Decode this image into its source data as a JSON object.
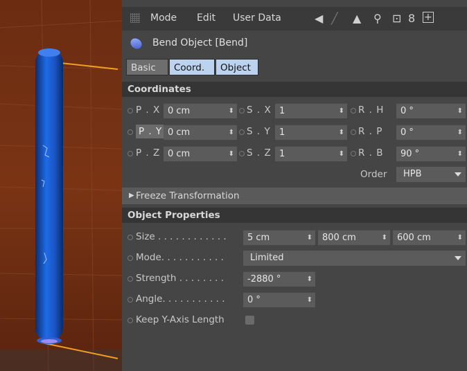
{
  "menu": {
    "mode": "Mode",
    "edit": "Edit",
    "userdata": "User Data"
  },
  "object_title": "Bend Object [Bend]",
  "tabs": [
    "Basic",
    "Coord.",
    "Object"
  ],
  "sections": {
    "coordinates": "Coordinates",
    "object_properties": "Object Properties",
    "freeze": "Freeze Transformation"
  },
  "coords": {
    "position": [
      {
        "label": "P . X",
        "value": "0 cm"
      },
      {
        "label": "P . Y",
        "value": "0 cm"
      },
      {
        "label": "P . Z",
        "value": "0 cm"
      }
    ],
    "scale": [
      {
        "label": "S . X",
        "value": "1"
      },
      {
        "label": "S . Y",
        "value": "1"
      },
      {
        "label": "S . Z",
        "value": "1"
      }
    ],
    "rotation": [
      {
        "label": "R . H",
        "value": "0 °"
      },
      {
        "label": "R . P",
        "value": "0 °"
      },
      {
        "label": "R . B",
        "value": "90 °"
      }
    ],
    "order_label": "Order",
    "order_value": "HPB"
  },
  "properties": {
    "size_label": "Size . . . . . . . . . . . .",
    "size_values": [
      "5 cm",
      "800 cm",
      "600 cm"
    ],
    "mode_label": "Mode. . . . . . . . . . .",
    "mode_value": "Limited",
    "strength_label": "Strength . . . . . . . .",
    "strength_value": "-2880 °",
    "angle_label": "Angle. . . . . . . . . . .",
    "angle_value": "0 °",
    "keep_label": "Keep Y-Axis Length"
  },
  "colors": {
    "accent_tab": "#bcd3ef",
    "panel_bg": "#454545",
    "field_bg": "#5b5b5b"
  }
}
